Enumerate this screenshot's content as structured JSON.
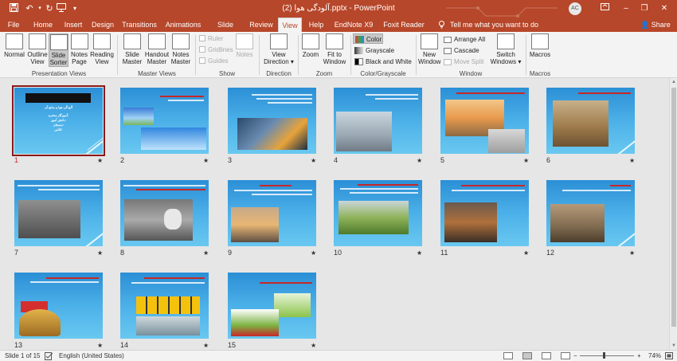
{
  "app": {
    "title": "آلودگی هوا (2).pptx  -  PowerPoint",
    "user_initials": "AC",
    "brand_color": "#b7472a"
  },
  "quick_access": {
    "save_icon": "save-icon",
    "undo_icon": "undo-icon",
    "repeat_icon": "repeat-icon",
    "present_icon": "present-icon",
    "customize_icon": "chevron-down-icon"
  },
  "window_controls": {
    "ribbon_options_icon": "ribbon-display-icon",
    "minimize": "–",
    "restore": "❐",
    "close": "✕"
  },
  "tabs": [
    {
      "label": "File"
    },
    {
      "label": "Home"
    },
    {
      "label": "Insert"
    },
    {
      "label": "Design"
    },
    {
      "label": "Transitions"
    },
    {
      "label": "Animations"
    },
    {
      "label": "Slide Show"
    },
    {
      "label": "Review"
    },
    {
      "label": "View",
      "active": true
    },
    {
      "label": "Help"
    },
    {
      "label": "EndNote X9"
    },
    {
      "label": "Foxit Reader PDF"
    },
    {
      "label": "Tell me what you want to do"
    }
  ],
  "share_label": "Share",
  "ribbon": {
    "presentation_views": {
      "group_label": "Presentation Views",
      "normal": "Normal",
      "outline": "Outline",
      "outline2": "View",
      "sorter": "Slide",
      "sorter2": "Sorter",
      "notes": "Notes",
      "notes2": "Page",
      "reading": "Reading",
      "reading2": "View"
    },
    "master_views": {
      "group_label": "Master Views",
      "slide_master": "Slide",
      "slide_master2": "Master",
      "handout_master": "Handout",
      "handout_master2": "Master",
      "notes_master": "Notes",
      "notes_master2": "Master"
    },
    "show": {
      "group_label": "Show",
      "ruler": "Ruler",
      "gridlines": "Gridlines",
      "guides": "Guides",
      "notes": "Notes"
    },
    "direction": {
      "group_label": "Direction",
      "view_direction": "View",
      "view_direction2": "Direction ▾"
    },
    "zoom": {
      "group_label": "Zoom",
      "zoom": "Zoom",
      "fit": "Fit to",
      "fit2": "Window"
    },
    "color": {
      "group_label": "Color/Grayscale",
      "color": "Color",
      "grayscale": "Grayscale",
      "bw": "Black and White"
    },
    "window": {
      "group_label": "Window",
      "new_window": "New",
      "new_window2": "Window",
      "arrange_all": "Arrange All",
      "cascade": "Cascade",
      "move_split": "Move Split",
      "switch": "Switch",
      "switch2": "Windows ▾"
    },
    "macros": {
      "group_label": "Macros",
      "macros": "Macros"
    },
    "collapse_icon": "chevron-up-icon"
  },
  "slides": [
    {
      "num": "1",
      "star": "★",
      "selected": true
    },
    {
      "num": "2",
      "star": "★"
    },
    {
      "num": "3",
      "star": "★"
    },
    {
      "num": "4",
      "star": "★"
    },
    {
      "num": "5",
      "star": "★"
    },
    {
      "num": "6",
      "star": "★"
    },
    {
      "num": "7",
      "star": "★"
    },
    {
      "num": "8",
      "star": "★"
    },
    {
      "num": "9",
      "star": "★"
    },
    {
      "num": "10",
      "star": "★"
    },
    {
      "num": "11",
      "star": "★"
    },
    {
      "num": "12",
      "star": "★"
    },
    {
      "num": "13",
      "star": "★"
    },
    {
      "num": "14",
      "star": "★"
    },
    {
      "num": "15",
      "star": "★"
    }
  ],
  "slide1": {
    "title": "آلودگی هوا و منابع آن",
    "l1": "آموزگار محترم:",
    "l2": "دانش آموز:",
    "l3": "دبستان:",
    "l4": "کلاس:"
  },
  "status": {
    "slide_info": "Slide 1 of 15",
    "language": "English (United States)",
    "zoom_percent": "74%",
    "zoom_out": "−",
    "zoom_in": "+"
  }
}
